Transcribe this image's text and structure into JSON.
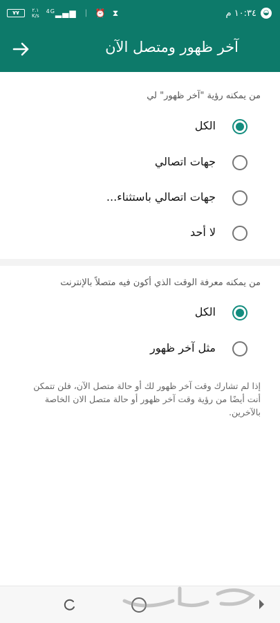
{
  "status_bar": {
    "time": "١٠:٣٤ م",
    "battery": "٧٧",
    "network_speed": "٢.١\nK/s",
    "network_type": "4G",
    "icons": [
      "timer-icon",
      "alarm-icon",
      "vibrate-icon",
      "signal-icon",
      "battery-icon"
    ]
  },
  "app_bar": {
    "title": "آخر ظهور ومتصل الآن",
    "back_icon": "arrow-back-icon"
  },
  "last_seen_section": {
    "header": "من يمكنه رؤية \"آخر ظهور\" لي",
    "options": [
      {
        "label": "الكل",
        "selected": true
      },
      {
        "label": "جهات اتصالي",
        "selected": false
      },
      {
        "label": "جهات اتصالي باستثناء...",
        "selected": false
      },
      {
        "label": "لا أحد",
        "selected": false
      }
    ]
  },
  "online_section": {
    "header": "من يمكنه معرفة الوقت الذي أكون فيه متصلاً بالإنترنت",
    "options": [
      {
        "label": "الكل",
        "selected": true
      },
      {
        "label": "مثل آخر ظهور",
        "selected": false
      }
    ]
  },
  "footnote": "إذا لم تشارك وقت آخر ظهور لك أو حالة متصل الآن، فلن تتمكن أنت أيضًا من رؤية وقت آخر ظهور أو حالة متصل الان الخاصة بالآخرين.",
  "colors": {
    "primary": "#0d7a6a",
    "accent": "#128c7e",
    "text": "#111111",
    "secondary_text": "#666666"
  }
}
